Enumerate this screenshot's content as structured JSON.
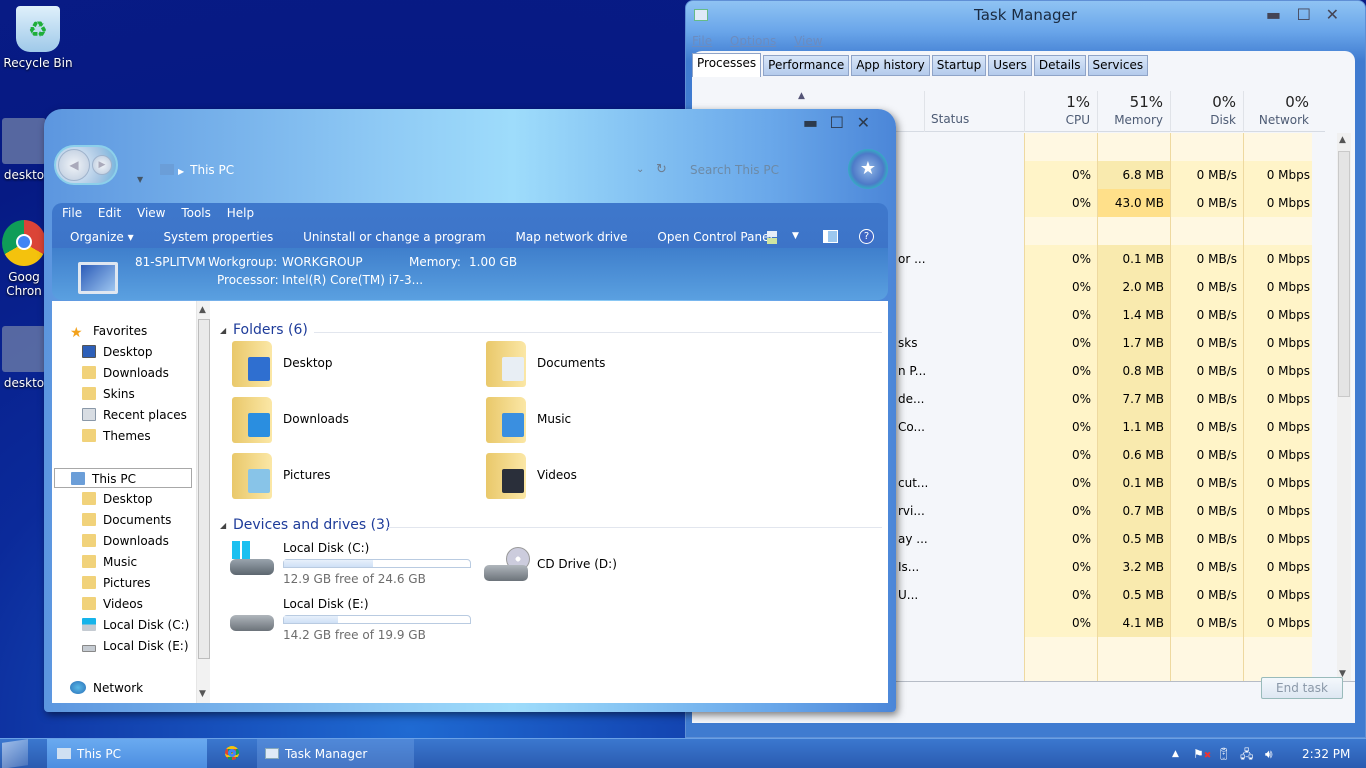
{
  "desktop": {
    "icons": [
      {
        "label": "Recycle Bin",
        "icon": "recycle-bin-icon"
      },
      {
        "label": "deskto",
        "icon": "settings-file-icon"
      },
      {
        "label": "Goog Chron",
        "icon": "chrome-icon"
      },
      {
        "label": "deskto",
        "icon": "settings-file-icon"
      }
    ]
  },
  "task_manager": {
    "title": "Task Manager",
    "menu": [
      "File",
      "Options",
      "View"
    ],
    "tabs": [
      "Processes",
      "Performance",
      "App history",
      "Startup",
      "Users",
      "Details",
      "Services"
    ],
    "active_tab": "Processes",
    "columns": {
      "status": "Status",
      "cpu": {
        "pct": "1%",
        "label": "CPU"
      },
      "memory": {
        "pct": "51%",
        "label": "Memory"
      },
      "disk": {
        "pct": "0%",
        "label": "Disk"
      },
      "network": {
        "pct": "0%",
        "label": "Network"
      }
    },
    "rows": [
      {
        "name": "",
        "cpu": "",
        "memory": "",
        "disk": "",
        "network": "",
        "group": true
      },
      {
        "name": "",
        "cpu": "0%",
        "memory": "6.8 MB",
        "disk": "0 MB/s",
        "network": "0 Mbps"
      },
      {
        "name": "",
        "cpu": "0%",
        "memory": "43.0 MB",
        "disk": "0 MB/s",
        "network": "0 Mbps",
        "highlight": true
      },
      {
        "name": "",
        "cpu": "",
        "memory": "",
        "disk": "",
        "network": "",
        "group": true
      },
      {
        "name": "or ...",
        "cpu": "0%",
        "memory": "0.1 MB",
        "disk": "0 MB/s",
        "network": "0 Mbps"
      },
      {
        "name": "",
        "cpu": "0%",
        "memory": "2.0 MB",
        "disk": "0 MB/s",
        "network": "0 Mbps"
      },
      {
        "name": "",
        "cpu": "0%",
        "memory": "1.4 MB",
        "disk": "0 MB/s",
        "network": "0 Mbps"
      },
      {
        "name": "sks",
        "cpu": "0%",
        "memory": "1.7 MB",
        "disk": "0 MB/s",
        "network": "0 Mbps"
      },
      {
        "name": "n P...",
        "cpu": "0%",
        "memory": "0.8 MB",
        "disk": "0 MB/s",
        "network": "0 Mbps"
      },
      {
        "name": "de...",
        "cpu": "0%",
        "memory": "7.7 MB",
        "disk": "0 MB/s",
        "network": "0 Mbps"
      },
      {
        "name": "Co...",
        "cpu": "0%",
        "memory": "1.1 MB",
        "disk": "0 MB/s",
        "network": "0 Mbps"
      },
      {
        "name": "",
        "cpu": "0%",
        "memory": "0.6 MB",
        "disk": "0 MB/s",
        "network": "0 Mbps"
      },
      {
        "name": "cut...",
        "cpu": "0%",
        "memory": "0.1 MB",
        "disk": "0 MB/s",
        "network": "0 Mbps"
      },
      {
        "name": "rvi...",
        "cpu": "0%",
        "memory": "0.7 MB",
        "disk": "0 MB/s",
        "network": "0 Mbps"
      },
      {
        "name": "ay ...",
        "cpu": "0%",
        "memory": "0.5 MB",
        "disk": "0 MB/s",
        "network": "0 Mbps"
      },
      {
        "name": "Is...",
        "cpu": "0%",
        "memory": "3.2 MB",
        "disk": "0 MB/s",
        "network": "0 Mbps"
      },
      {
        "name": "U...",
        "cpu": "0%",
        "memory": "0.5 MB",
        "disk": "0 MB/s",
        "network": "0 Mbps"
      },
      {
        "name": "",
        "cpu": "0%",
        "memory": "4.1 MB",
        "disk": "0 MB/s",
        "network": "0 Mbps"
      }
    ],
    "end_task": "End task"
  },
  "explorer": {
    "breadcrumb": "This PC",
    "search_placeholder": "Search This PC",
    "menu": [
      "File",
      "Edit",
      "View",
      "Tools",
      "Help"
    ],
    "commands": [
      "Organize ▾",
      "System properties",
      "Uninstall or change a program",
      "Map network drive",
      "Open Control Panel"
    ],
    "info": {
      "name": "81-SPLITVM",
      "workgroup_label": "Workgroup:",
      "workgroup": "WORKGROUP",
      "memory_label": "Memory:",
      "memory": "1.00 GB",
      "processor_label": "Processor:",
      "processor": "Intel(R) Core(TM) i7-3..."
    },
    "nav": {
      "favorites_label": "Favorites",
      "favorites": [
        "Desktop",
        "Downloads",
        "Skins",
        "Recent places",
        "Themes"
      ],
      "thispc_label": "This PC",
      "thispc": [
        "Desktop",
        "Documents",
        "Downloads",
        "Music",
        "Pictures",
        "Videos",
        "Local Disk (C:)",
        "Local Disk (E:)"
      ],
      "network_label": "Network"
    },
    "folders_header": "Folders (6)",
    "folders": [
      "Desktop",
      "Documents",
      "Downloads",
      "Music",
      "Pictures",
      "Videos"
    ],
    "drives_header": "Devices and drives (3)",
    "drives": [
      {
        "name": "Local Disk (C:)",
        "free": "12.9 GB free of 24.6 GB",
        "used_fraction": 0.48
      },
      {
        "name": "CD Drive (D:)"
      },
      {
        "name": "Local Disk (E:)",
        "free": "14.2 GB free of 19.9 GB",
        "used_fraction": 0.29
      }
    ]
  },
  "taskbar": {
    "items": [
      "This PC",
      "",
      "Task Manager"
    ],
    "clock": "2:32 PM"
  }
}
